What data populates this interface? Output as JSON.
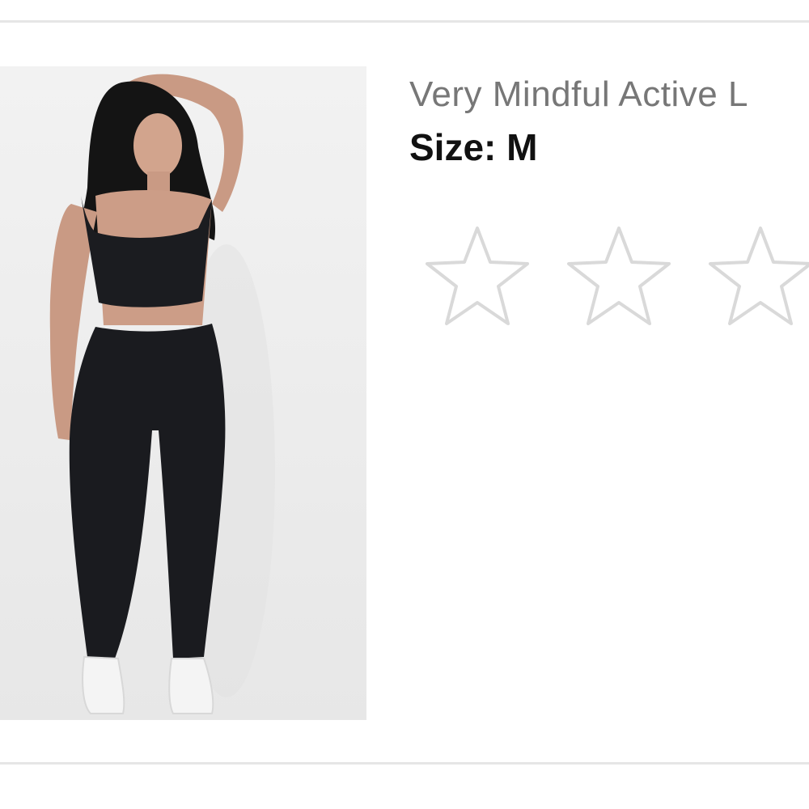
{
  "product": {
    "name": "Very Mindful Active L",
    "size_label": "Size:",
    "size_value": "M",
    "image_icon": "model-photo-black-activewear"
  },
  "rating": {
    "stars_visible": 3,
    "selected": 0,
    "star_stroke": "#d9d9d9",
    "star_fill": "#ffffff"
  },
  "colors": {
    "divider": "#e6e6e6",
    "name_text": "#777777",
    "size_text": "#111111"
  }
}
